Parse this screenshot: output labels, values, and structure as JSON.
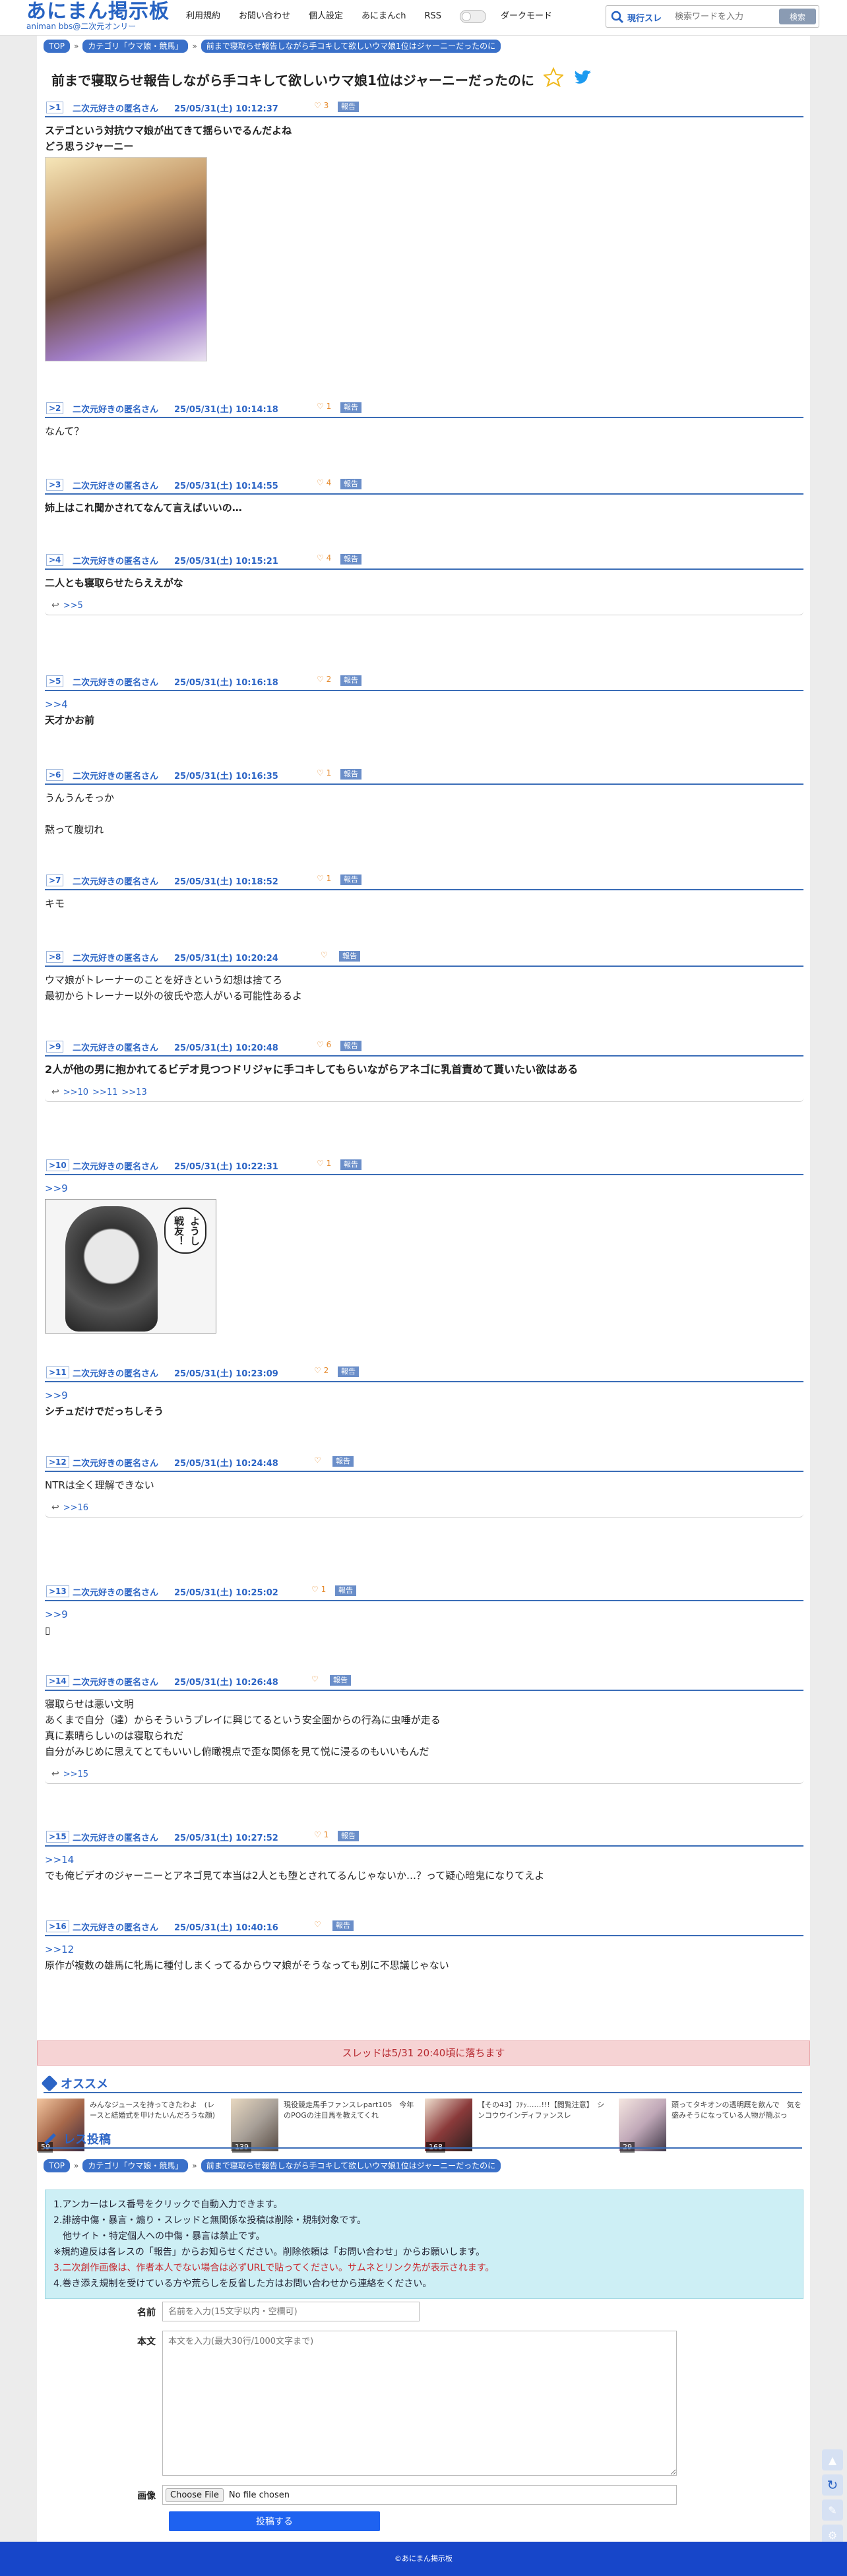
{
  "header": {
    "logo_main": "あにまん掲示板",
    "logo_sub": "animan bbs@二次元オンリー",
    "nav": [
      "利用規約",
      "お問い合わせ",
      "個人設定",
      "あにまんch",
      "RSS"
    ],
    "dark_mode": "ダークモード",
    "search_scope": "現行スレ",
    "search_placeholder": "検索ワードを入力",
    "search_button": "検索"
  },
  "breadcrumb": [
    "TOP",
    "カテゴリ「ウマ娘・競馬」",
    "前まで寝取らせ報告しながら手コキして欲しいウマ娘1位はジャーニーだったのに"
  ],
  "breadcrumb_sep": "»",
  "thread_title": "前まで寝取らせ報告しながら手コキして欲しいウマ娘1位はジャーニーだったのに",
  "report_label": "報告",
  "posts": [
    {
      "no": ">1",
      "name": "二次元好きの匿名さん",
      "date": "25/05/31(土) 10:12:37",
      "likes": "3",
      "lines": [
        "ステゴという対抗ウマ娘が出てきて揺らいでるんだよね",
        "どう思うジャーニー"
      ],
      "bold": true
    },
    {
      "no": ">2",
      "name": "二次元好きの匿名さん",
      "date": "25/05/31(土) 10:14:18",
      "likes": "1",
      "lines": [
        "なんて？"
      ]
    },
    {
      "no": ">3",
      "name": "二次元好きの匿名さん",
      "date": "25/05/31(土) 10:14:55",
      "likes": "4",
      "lines": [
        "姉上はこれ聞かされてなんて言えばいいの…"
      ],
      "bold": true
    },
    {
      "no": ">4",
      "name": "二次元好きの匿名さん",
      "date": "25/05/31(土) 10:15:21",
      "likes": "4",
      "lines": [
        "二人とも寝取らせたらええがな"
      ],
      "bold": true,
      "refs": [
        ">>5"
      ]
    },
    {
      "no": ">5",
      "name": "二次元好きの匿名さん",
      "date": "25/05/31(土) 10:16:18",
      "likes": "2",
      "anchor": ">>4",
      "lines": [
        "天才かお前"
      ],
      "bold": true
    },
    {
      "no": ">6",
      "name": "二次元好きの匿名さん",
      "date": "25/05/31(土) 10:16:35",
      "likes": "1",
      "lines": [
        "うんうんそっか",
        "",
        "黙って腹切れ"
      ]
    },
    {
      "no": ">7",
      "name": "二次元好きの匿名さん",
      "date": "25/05/31(土) 10:18:52",
      "likes": "1",
      "lines": [
        "キモ"
      ]
    },
    {
      "no": ">8",
      "name": "二次元好きの匿名さん",
      "date": "25/05/31(土) 10:20:24",
      "likes": "",
      "lines": [
        "ウマ娘がトレーナーのことを好きという幻想は捨てろ",
        "最初からトレーナー以外の彼氏や恋人がいる可能性あるよ"
      ]
    },
    {
      "no": ">9",
      "name": "二次元好きの匿名さん",
      "date": "25/05/31(土) 10:20:48",
      "likes": "6",
      "lines": [
        "2人が他の男に抱かれてるビデオ見つつドリジャに手コキしてもらいながらアネゴに乳首責めて貰いたい欲はある"
      ],
      "bold": true,
      "big": true,
      "refs": [
        ">>10",
        ">>11",
        ">>13"
      ]
    },
    {
      "no": ">10",
      "name": "二次元好きの匿名さん",
      "date": "25/05/31(土) 10:22:31",
      "likes": "1",
      "anchor": ">>9",
      "lines": []
    },
    {
      "no": ">11",
      "name": "二次元好きの匿名さん",
      "date": "25/05/31(土) 10:23:09",
      "likes": "2",
      "anchor": ">>9",
      "lines": [
        "シチュだけでだっちしそう"
      ],
      "bold": true
    },
    {
      "no": ">12",
      "name": "二次元好きの匿名さん",
      "date": "25/05/31(土) 10:24:48",
      "likes": "",
      "lines": [
        "NTRは全く理解できない"
      ],
      "refs": [
        ">>16"
      ]
    },
    {
      "no": ">13",
      "name": "二次元好きの匿名さん",
      "date": "25/05/31(土) 10:25:02",
      "likes": "1",
      "anchor": ">>9",
      "lines": [
        "▯"
      ]
    },
    {
      "no": ">14",
      "name": "二次元好きの匿名さん",
      "date": "25/05/31(土) 10:26:48",
      "likes": "",
      "lines": [
        "寝取らせは悪い文明",
        "あくまで自分（達）からそういうプレイに興じてるという安全圏からの行為に虫唾が走る",
        "真に素晴らしいのは寝取られだ",
        "自分がみじめに思えてとてもいいし俯瞰視点で歪な関係を見て悦に浸るのもいいもんだ"
      ],
      "refs": [
        ">>15"
      ]
    },
    {
      "no": ">15",
      "name": "二次元好きの匿名さん",
      "date": "25/05/31(土) 10:27:52",
      "likes": "1",
      "anchor": ">>14",
      "lines": [
        "でも俺ビデオのジャーニーとアネゴ見て本当は2人とも堕とされてるんじゃないか…？って疑心暗鬼になりてえよ"
      ]
    },
    {
      "no": ">16",
      "name": "二次元好きの匿名さん",
      "date": "25/05/31(土) 10:40:16",
      "likes": "",
      "anchor": ">>12",
      "lines": [
        "原作が複数の雄馬に牝馬に種付しまくってるからウマ娘がそうなっても別に不思議じゃない"
      ]
    }
  ],
  "img2_caption": "ようし戦友！",
  "expire_notice": "スレッドは5/31 20:40頃に落ちます",
  "reco": {
    "title": "オススメ",
    "items": [
      {
        "text": "みんなジュースを持ってきたわよ　(レースと結婚式を甲けたいんだろうな顔)",
        "count": "59"
      },
      {
        "text": "現役競走馬手ファンスレpart105　今年のPOGの注目馬を教えてくれ",
        "count": "139"
      },
      {
        "text": "【その43】ﾌﾃｯ……!!!【閲覧注意】　シンコウウインディファンスレ",
        "count": "168"
      },
      {
        "text": "頭ってタキオンの透明厩を飲んで　気を盛みそうになっている人物が簡ぶっ",
        "count": "29"
      }
    ]
  },
  "post_form": {
    "title": "レス投稿",
    "guide": [
      "1.アンカーはレス番号をクリックで自動入力できます。",
      "2.誹謗中傷・暴言・煽り・スレッドと無関係な投稿は削除・規制対象です。",
      "　他サイト・特定個人への中傷・暴言は禁止です。",
      "※規約違反は各レスの「報告」からお知らせください。削除依頼は「お問い合わせ」からお願いします。",
      "3.二次創作画像は、作者本人でない場合は必ずURLで貼ってください。サムネとリンク先が表示されます。",
      "4.巻き添え規制を受けている方や荒らしを反省した方はお問い合わせから連絡をください。"
    ],
    "name_label": "名前",
    "name_placeholder": "名前を入力(15文字以内・空欄可)",
    "body_label": "本文",
    "body_placeholder": "本文を入力(最大30行/1000文字まで)",
    "image_label": "画像",
    "file_button": "Choose File",
    "file_status": "No file chosen",
    "submit": "投稿する"
  },
  "footer": "©あにまん掲示板",
  "colors": {
    "accent": "#2b64c5",
    "report": "#6a8ec9",
    "expire_bg": "#f6d3d4",
    "guide_bg": "#cdeff5",
    "footer": "#1746c9"
  }
}
